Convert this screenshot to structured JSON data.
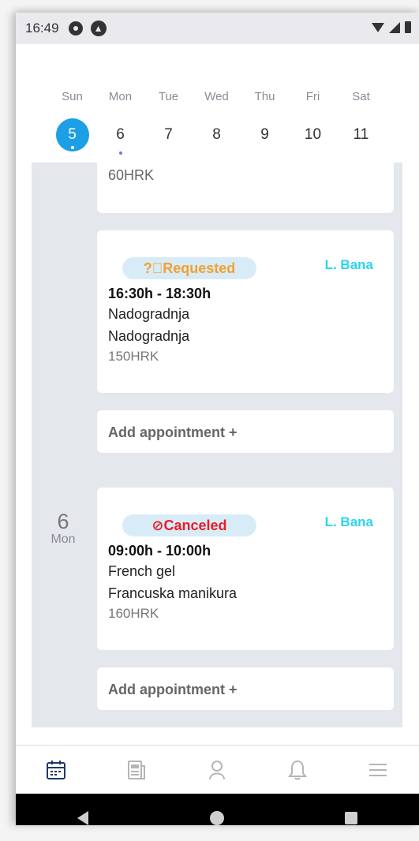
{
  "status_bar": {
    "time": "16:49",
    "icons": [
      "gear-icon",
      "alert-icon",
      "wifi-icon",
      "signal-icon",
      "battery-icon"
    ]
  },
  "week": {
    "days": [
      {
        "name": "Sun",
        "num": "5",
        "selected": true,
        "dot": "white"
      },
      {
        "name": "Mon",
        "num": "6",
        "selected": false,
        "dot": "purple"
      },
      {
        "name": "Tue",
        "num": "7",
        "selected": false,
        "dot": null
      },
      {
        "name": "Wed",
        "num": "8",
        "selected": false,
        "dot": null
      },
      {
        "name": "Thu",
        "num": "9",
        "selected": false,
        "dot": null
      },
      {
        "name": "Fri",
        "num": "10",
        "selected": false,
        "dot": null
      },
      {
        "name": "Sat",
        "num": "11",
        "selected": false,
        "dot": null
      }
    ],
    "accent_color": "#1c9fe4",
    "handle_color": "#7b6fe6"
  },
  "schedule": {
    "partial_card": {
      "price": "60HRK"
    },
    "appointments": [
      {
        "status": "Requested",
        "status_icon": "question-circle-icon",
        "status_color": "#f2a12e",
        "staff": "L. Bana",
        "time": "16:30h - 18:30h",
        "service": "Nadogradnja",
        "service_detail": "Nadogradnja",
        "price": "150HRK"
      },
      {
        "status": "Canceled",
        "status_icon": "prohibited-icon",
        "status_color": "#ec1c24",
        "staff": "L. Bana",
        "time": "09:00h - 10:00h",
        "service": "French gel",
        "service_detail": "Francuska manikura",
        "price": "160HRK"
      }
    ],
    "add_label": "Add appointment +",
    "date_group": {
      "num": "6",
      "day": "Mon"
    }
  },
  "bottom_nav": [
    "calendar-icon",
    "news-icon",
    "profile-icon",
    "bell-icon",
    "menu-icon"
  ],
  "system_nav": [
    "back-icon",
    "home-icon",
    "recents-icon"
  ]
}
